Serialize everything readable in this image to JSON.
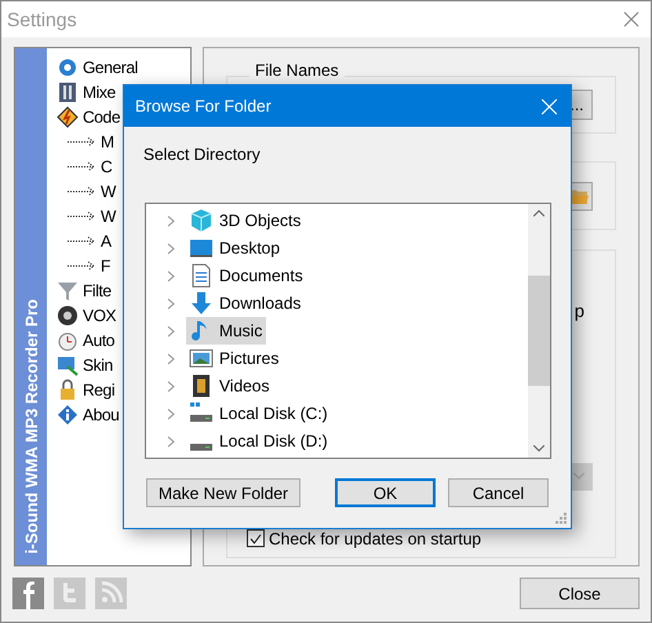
{
  "window": {
    "title": "Settings"
  },
  "banner": "i-Sound WMA MP3 Recorder Pro",
  "tree": [
    {
      "label": "General",
      "kind": "gear"
    },
    {
      "label": "Mixe",
      "kind": "mixer"
    },
    {
      "label": "Code",
      "kind": "codec",
      "children": [
        {
          "label": "M"
        },
        {
          "label": "C"
        },
        {
          "label": "W"
        },
        {
          "label": "W"
        },
        {
          "label": "A"
        },
        {
          "label": "F"
        }
      ]
    },
    {
      "label": "Filte",
      "kind": "filter"
    },
    {
      "label": "VOX",
      "kind": "vox"
    },
    {
      "label": "Auto",
      "kind": "clock"
    },
    {
      "label": "Skin",
      "kind": "skin"
    },
    {
      "label": "Regi",
      "kind": "lock"
    },
    {
      "label": "Abou",
      "kind": "info"
    }
  ],
  "panel": {
    "group_title": "File Names",
    "browse_button": "...",
    "fragment": "p",
    "dropdown": {
      "disabled": true
    },
    "update_check": {
      "label": "Check for updates on startup",
      "checked": true
    }
  },
  "footer": {
    "close_button": "Close"
  },
  "dialog": {
    "title": "Browse For Folder",
    "prompt": "Select Directory",
    "folders": [
      {
        "label": "3D Objects",
        "kind": "objects",
        "selected": false
      },
      {
        "label": "Desktop",
        "kind": "desktop",
        "selected": false
      },
      {
        "label": "Documents",
        "kind": "documents",
        "selected": false
      },
      {
        "label": "Downloads",
        "kind": "downloads",
        "selected": false
      },
      {
        "label": "Music",
        "kind": "music",
        "selected": true
      },
      {
        "label": "Pictures",
        "kind": "pictures",
        "selected": false
      },
      {
        "label": "Videos",
        "kind": "videos",
        "selected": false
      },
      {
        "label": "Local Disk (C:)",
        "kind": "system_disk",
        "selected": false
      },
      {
        "label": "Local Disk (D:)",
        "kind": "disk",
        "selected": false
      }
    ],
    "buttons": [
      {
        "label": "Make New Folder",
        "default": false
      },
      {
        "label": "OK",
        "default": true
      },
      {
        "label": "Cancel",
        "default": false
      }
    ]
  }
}
